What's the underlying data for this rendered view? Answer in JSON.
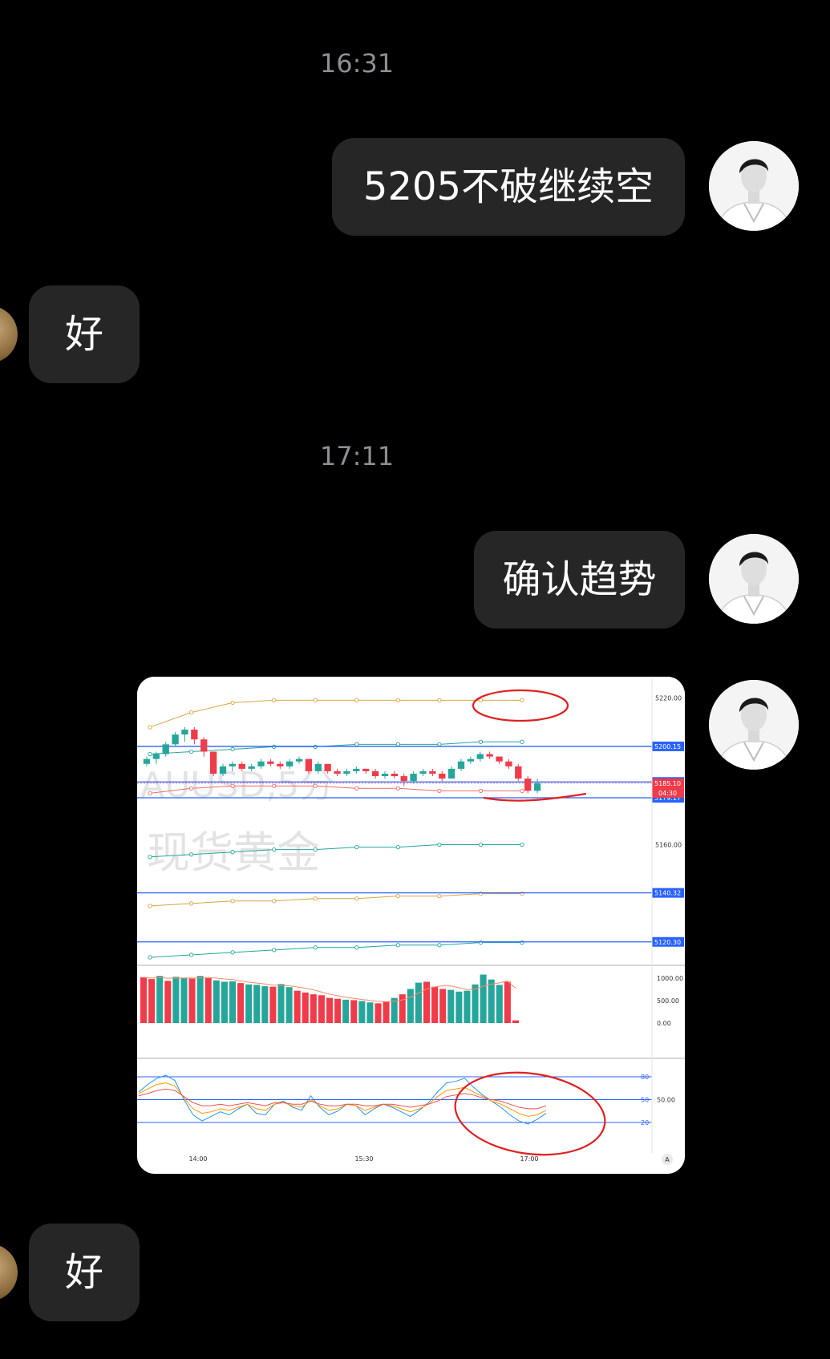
{
  "chat": {
    "timestamps": [
      "16:31",
      "17:11"
    ],
    "messages": [
      {
        "side": "me",
        "text": "5205不破继续空"
      },
      {
        "side": "peer",
        "text": "好"
      },
      {
        "side": "me",
        "text": "确认趋势"
      },
      {
        "side": "me",
        "type": "image"
      },
      {
        "side": "peer",
        "text": "好"
      }
    ]
  },
  "colors": {
    "background": "#000000",
    "bubble": "#262626",
    "bull": "#26a69a",
    "bear": "#ef3b4a",
    "level_line": "#2962ff",
    "annotation": "#e02020"
  },
  "chart_data": {
    "type": "candlestick",
    "symbol_watermark": "AUUSD,5分",
    "name_watermark": "现货黄金",
    "x_ticks": [
      "14:00",
      "15:30",
      "17:00"
    ],
    "price_axis": {
      "ylim": [
        5114,
        5226
      ],
      "ticks": [
        5220.0,
        5160.0
      ],
      "tick_labels": [
        "5220.00",
        "5160.00"
      ],
      "level_labels": [
        {
          "value": 5200.15,
          "label": "5200.15"
        },
        {
          "value": 5185.63,
          "label": "5185.63"
        },
        {
          "value": 5179.17,
          "label": "5179.17"
        },
        {
          "value": 5140.32,
          "label": "5140.32"
        },
        {
          "value": 5120.3,
          "label": "5120.30"
        }
      ],
      "last_price": {
        "value": 5185.1,
        "label": "5185.10",
        "countdown": "04:30"
      }
    },
    "candles": [
      [
        5193,
        5196,
        5192,
        5195
      ],
      [
        5195,
        5198,
        5193,
        5197
      ],
      [
        5197,
        5202,
        5196,
        5201
      ],
      [
        5201,
        5206,
        5200,
        5205
      ],
      [
        5205,
        5208,
        5202,
        5207
      ],
      [
        5207,
        5208,
        5201,
        5203
      ],
      [
        5203,
        5204,
        5196,
        5198
      ],
      [
        5198,
        5198,
        5188,
        5189
      ],
      [
        5189,
        5193,
        5188,
        5192
      ],
      [
        5192,
        5194,
        5190,
        5193
      ],
      [
        5193,
        5194,
        5190,
        5191
      ],
      [
        5191,
        5193,
        5190,
        5192
      ],
      [
        5192,
        5195,
        5191,
        5194
      ],
      [
        5194,
        5195,
        5192,
        5193
      ],
      [
        5193,
        5194,
        5191,
        5192
      ],
      [
        5192,
        5195,
        5191,
        5194
      ],
      [
        5194,
        5196,
        5193,
        5195
      ],
      [
        5195,
        5195,
        5189,
        5190
      ],
      [
        5190,
        5194,
        5189,
        5193
      ],
      [
        5193,
        5193,
        5189,
        5190
      ],
      [
        5190,
        5191,
        5188,
        5189
      ],
      [
        5189,
        5191,
        5188,
        5190
      ],
      [
        5190,
        5192,
        5189,
        5191
      ],
      [
        5191,
        5191,
        5189,
        5190
      ],
      [
        5190,
        5191,
        5187,
        5188
      ],
      [
        5188,
        5190,
        5187,
        5189
      ],
      [
        5189,
        5190,
        5187,
        5188
      ],
      [
        5188,
        5189,
        5184,
        5186
      ],
      [
        5186,
        5190,
        5185,
        5189
      ],
      [
        5189,
        5191,
        5188,
        5190
      ],
      [
        5190,
        5191,
        5188,
        5189
      ],
      [
        5189,
        5190,
        5186,
        5187
      ],
      [
        5187,
        5192,
        5187,
        5191
      ],
      [
        5191,
        5195,
        5190,
        5194
      ],
      [
        5194,
        5196,
        5193,
        5195
      ],
      [
        5195,
        5198,
        5194,
        5197
      ],
      [
        5197,
        5198,
        5195,
        5196
      ],
      [
        5196,
        5196,
        5193,
        5194
      ],
      [
        5194,
        5195,
        5191,
        5192
      ],
      [
        5192,
        5193,
        5186,
        5187
      ],
      [
        5187,
        5188,
        5181,
        5182
      ],
      [
        5182,
        5187,
        5181,
        5185.1
      ]
    ],
    "ma_lines": [
      {
        "color": "#d9a441",
        "values": [
          5208,
          5214,
          5218,
          5219,
          5219,
          5219,
          5219,
          5219,
          5219,
          5219
        ]
      },
      {
        "color": "#26a69a",
        "values": [
          5197,
          5198,
          5199,
          5200,
          5200,
          5201,
          5201,
          5201,
          5202,
          5202
        ]
      },
      {
        "color": "#ef6c6c",
        "values": [
          5181,
          5183,
          5184,
          5184,
          5184,
          5183,
          5183,
          5182,
          5182,
          5182
        ]
      },
      {
        "color": "#26a69a",
        "values": [
          5155,
          5156,
          5157,
          5158,
          5158,
          5159,
          5159,
          5160,
          5160,
          5160
        ]
      },
      {
        "color": "#d9a441",
        "values": [
          5135,
          5136,
          5137,
          5137,
          5138,
          5138,
          5139,
          5139,
          5140,
          5140
        ]
      },
      {
        "color": "#26a69a",
        "values": [
          5114,
          5115,
          5116,
          5117,
          5118,
          5118,
          5119,
          5119,
          5120,
          5120
        ]
      }
    ],
    "volume": {
      "ylim": [
        0,
        1250
      ],
      "tick_labels": [
        "1000.00",
        "500.00",
        "0.00"
      ],
      "ticks": [
        1000,
        500,
        0
      ],
      "values": [
        1020,
        980,
        1050,
        940,
        1030,
        1010,
        990,
        1050,
        1000,
        950,
        920,
        930,
        890,
        860,
        850,
        820,
        810,
        870,
        800,
        720,
        680,
        640,
        620,
        560,
        540,
        520,
        510,
        490,
        460,
        440,
        480,
        560,
        640,
        760,
        900,
        920,
        810,
        760,
        740,
        700,
        720,
        860,
        1080,
        970,
        850,
        920,
        60
      ],
      "up": [
        0,
        0,
        1,
        0,
        1,
        1,
        0,
        1,
        0,
        1,
        1,
        1,
        0,
        1,
        1,
        1,
        0,
        1,
        1,
        0,
        0,
        0,
        0,
        0,
        0,
        1,
        0,
        1,
        1,
        0,
        0,
        1,
        0,
        1,
        1,
        0,
        0,
        0,
        1,
        1,
        1,
        1,
        1,
        1,
        1,
        0,
        0
      ]
    },
    "oscillator": {
      "ylim": [
        0,
        100
      ],
      "levels": [
        80,
        50,
        20
      ],
      "level_labels": [
        "80",
        "50",
        "20"
      ],
      "value_label": "50.00",
      "series": [
        {
          "color": "#2196f3",
          "values": [
            60,
            70,
            78,
            82,
            75,
            50,
            30,
            22,
            28,
            34,
            30,
            38,
            44,
            32,
            30,
            44,
            48,
            40,
            36,
            55,
            40,
            30,
            35,
            44,
            42,
            30,
            38,
            44,
            40,
            34,
            28,
            36,
            46,
            60,
            72,
            74,
            78,
            66,
            56,
            48,
            40,
            30,
            22,
            18,
            24,
            32
          ]
        },
        {
          "color": "#ff9800",
          "values": [
            58,
            64,
            70,
            72,
            68,
            52,
            38,
            32,
            34,
            38,
            36,
            40,
            44,
            38,
            36,
            44,
            46,
            42,
            40,
            50,
            42,
            36,
            38,
            44,
            42,
            36,
            40,
            44,
            42,
            38,
            34,
            38,
            44,
            54,
            62,
            64,
            66,
            60,
            54,
            48,
            44,
            38,
            32,
            28,
            30,
            36
          ]
        },
        {
          "color": "#ef5350",
          "values": [
            55,
            58,
            62,
            64,
            62,
            54,
            46,
            42,
            42,
            44,
            42,
            44,
            46,
            44,
            42,
            46,
            46,
            44,
            44,
            48,
            44,
            42,
            42,
            44,
            44,
            42,
            42,
            44,
            44,
            42,
            40,
            42,
            44,
            48,
            54,
            56,
            58,
            56,
            52,
            50,
            48,
            44,
            40,
            38,
            38,
            42
          ]
        }
      ]
    }
  }
}
